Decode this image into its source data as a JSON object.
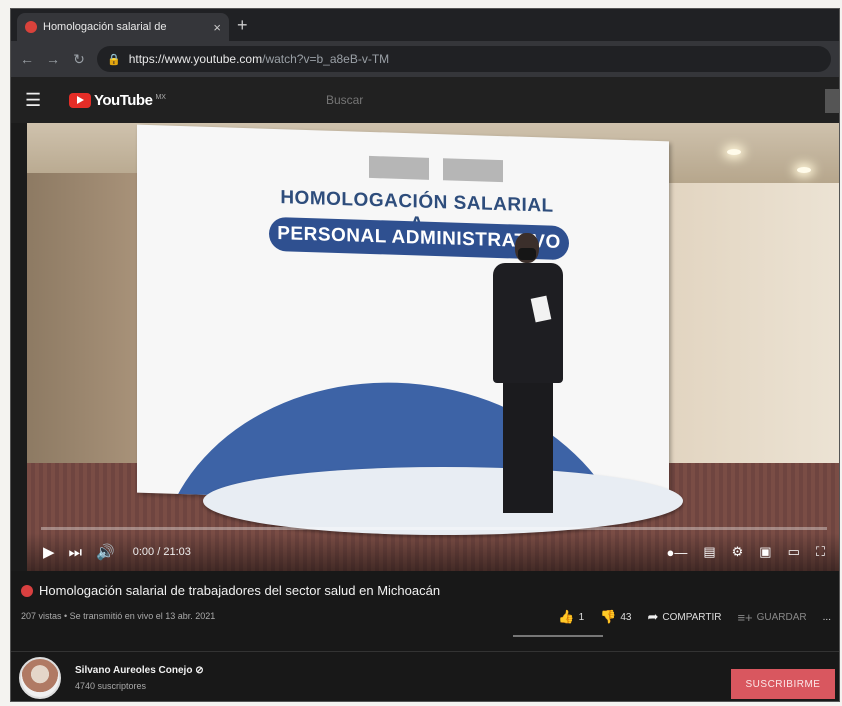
{
  "browser": {
    "tab_title": "Homologación salarial de",
    "tab_close": "×",
    "new_tab": "+",
    "url_host": "https://www.youtube.com",
    "url_path": "/watch?v=b_a8eB-v-TM"
  },
  "youtube": {
    "logo_text": "YouTube",
    "country": "MX",
    "search_placeholder": "Buscar"
  },
  "video": {
    "banner_title": "HOMOLOGACIÓN SALARIAL A",
    "banner_pill": "PERSONAL ADMINISTRATIVO",
    "time": "0:00 / 21:03",
    "progress": 0.0
  },
  "info": {
    "title": "Homologación salarial de trabajadores del sector salud en Michoacán",
    "meta": "207 vistas • Se transmitió en vivo el 13 abr. 2021",
    "likes": "1",
    "dislikes": "43",
    "share_label": "COMPARTIR",
    "save_label": "GUARDAR",
    "more": "..."
  },
  "channel": {
    "name": "Silvano Aureoles Conejo",
    "verified": "⊘",
    "subscribers": "4740 suscriptores",
    "subscribe_label": "SUSCRIBIRME"
  },
  "colors": {
    "accent": "#e52d27",
    "subscribe": "#d9575f",
    "banner_blue": "#2f5090"
  }
}
